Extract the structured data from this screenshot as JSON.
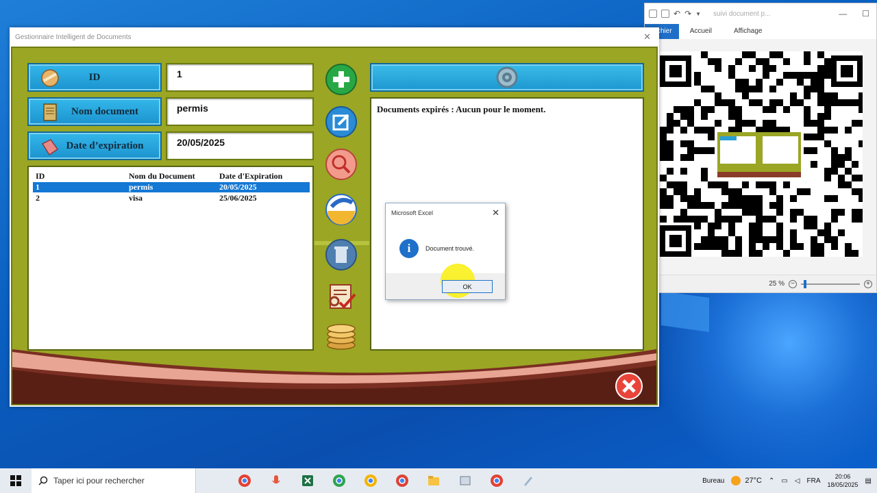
{
  "app": {
    "title": "Gestionnaire Intelligent de Documents",
    "close_glyph": "✕",
    "fields": {
      "id_label": "ID",
      "id_value": "1",
      "name_label": "Nom document",
      "name_value": "permis",
      "date_label": "Date d’expiration",
      "date_value": "20/05/2025"
    },
    "grid": {
      "headers": [
        "ID",
        "Nom du Document",
        "Date d'Expiration"
      ],
      "rows": [
        {
          "id": "1",
          "name": "permis",
          "date": "20/05/2025",
          "selected": true
        },
        {
          "id": "2",
          "name": "visa",
          "date": "25/06/2025",
          "selected": false
        }
      ]
    },
    "info_text": "Documents expirés : Aucun pour le moment.",
    "colors": {
      "body": "#9aa624",
      "label_blue": "#1c93cf",
      "selected_row": "#1478d4",
      "exit_red": "#e8443a"
    }
  },
  "toolbar_icons": [
    "add-icon",
    "edit-icon",
    "search-icon",
    "clean-icon",
    "delete-icon",
    "check-list-icon",
    "coins-icon"
  ],
  "msgbox": {
    "title": "Microsoft Excel",
    "close_glyph": "✕",
    "icon_letter": "i",
    "message": "Document trouvé.",
    "ok_label": "OK"
  },
  "excel": {
    "title": "suivi document p...",
    "tabs": [
      "chier",
      "Accueil",
      "Affichage"
    ],
    "zoom": "25 %",
    "minimize_glyph": "—",
    "maximize_glyph": "☐"
  },
  "taskbar": {
    "search_placeholder": "Taper ici pour rechercher",
    "desktop_label": "Bureau",
    "weather": "27°C",
    "language": "FRA",
    "time": "20:06",
    "date": "18/05/2025"
  }
}
